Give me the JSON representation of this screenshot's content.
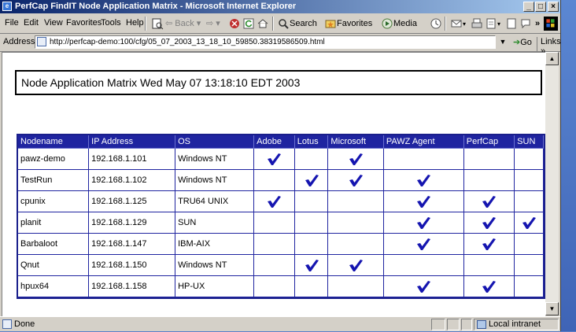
{
  "window": {
    "title": "PerfCap FindIT Node Application Matrix - Microsoft Internet Explorer",
    "controls": [
      "_",
      "□",
      "×"
    ]
  },
  "menu": {
    "items": [
      {
        "label": "File",
        "key": "F"
      },
      {
        "label": "Edit",
        "key": "E"
      },
      {
        "label": "View",
        "key": "V"
      },
      {
        "label": "Favorites",
        "key": "a"
      },
      {
        "label": "Tools",
        "key": "T"
      },
      {
        "label": "Help",
        "key": "H"
      }
    ]
  },
  "toolbar": {
    "back": "Back",
    "search": "Search",
    "favorites": "Favorites",
    "media": "Media",
    "overflow": "»"
  },
  "address": {
    "label": "Address",
    "url": "http://perfcap-demo:100/cfg/05_07_2003_13_18_10_59850.38319586509.html",
    "go": "Go",
    "links": "Links »"
  },
  "page": {
    "heading": "Node Application Matrix Wed May 07 13:18:10 EDT 2003"
  },
  "matrix": {
    "headers": [
      "Nodename",
      "IP Address",
      "OS",
      "Adobe",
      "Lotus",
      "Microsoft",
      "PAWZ Agent",
      "PerfCap",
      "SUN"
    ],
    "rows": [
      {
        "node": "pawz-demo",
        "ip": "192.168.1.101",
        "os": "Windows NT",
        "checks": [
          true,
          false,
          true,
          false,
          false,
          false
        ]
      },
      {
        "node": "TestRun",
        "ip": "192.168.1.102",
        "os": "Windows NT",
        "checks": [
          false,
          true,
          true,
          true,
          false,
          false
        ]
      },
      {
        "node": "cpunix",
        "ip": "192.168.1.125",
        "os": "TRU64 UNIX",
        "checks": [
          true,
          false,
          false,
          true,
          true,
          false
        ]
      },
      {
        "node": "planit",
        "ip": "192.168.1.129",
        "os": "SUN",
        "checks": [
          false,
          false,
          false,
          true,
          true,
          true
        ]
      },
      {
        "node": "Barbaloot",
        "ip": "192.168.1.147",
        "os": "IBM-AIX",
        "checks": [
          false,
          false,
          false,
          true,
          true,
          false
        ]
      },
      {
        "node": "Qnut",
        "ip": "192.168.1.150",
        "os": "Windows NT",
        "checks": [
          false,
          true,
          true,
          false,
          false,
          false
        ]
      },
      {
        "node": "hpux64",
        "ip": "192.168.1.158",
        "os": "HP-UX",
        "checks": [
          false,
          false,
          false,
          true,
          true,
          false
        ]
      }
    ]
  },
  "status": {
    "text": "Done",
    "zone": "Local intranet"
  },
  "colors": {
    "table_header": "#1f24a0",
    "check": "#1515b0"
  }
}
